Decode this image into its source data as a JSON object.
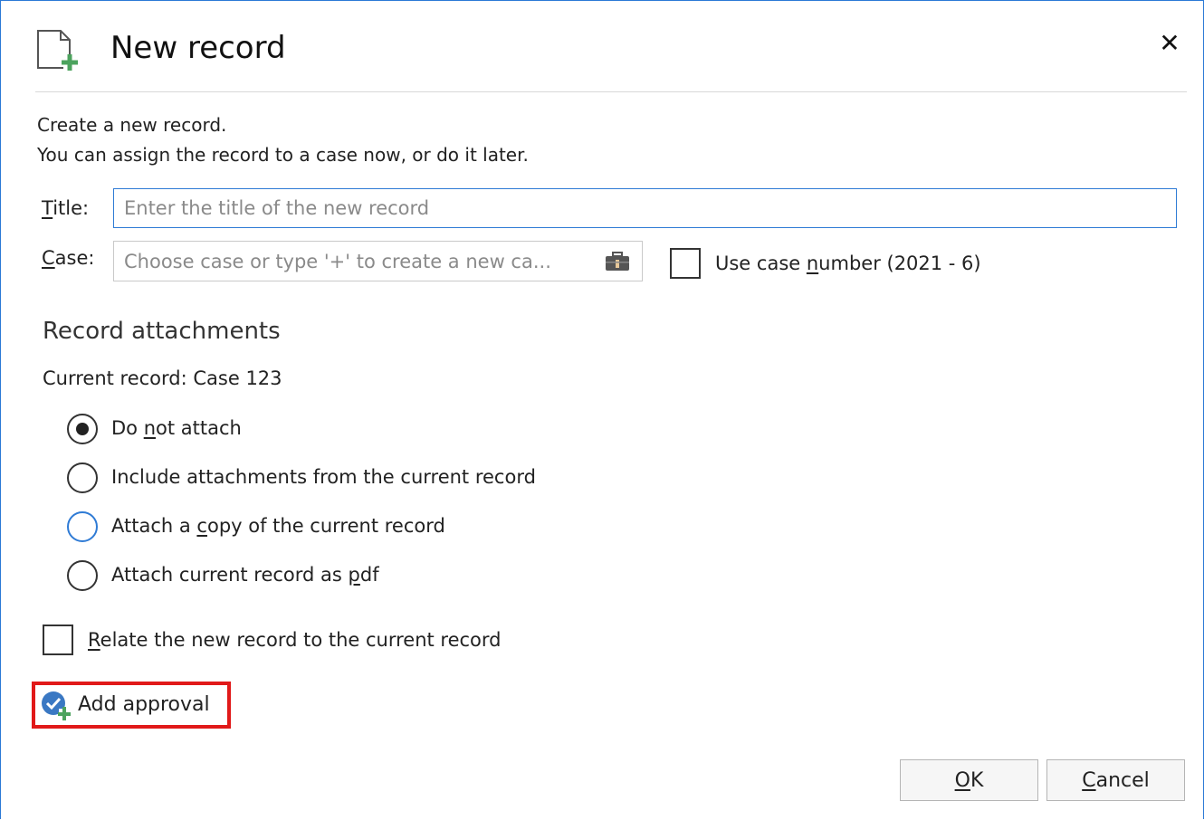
{
  "dialog": {
    "title": "New record",
    "close_glyph": "✕",
    "icon": "new-document-icon"
  },
  "intro": {
    "line1": "Create a new record.",
    "line2": "You can assign the record to a case now, or do it later."
  },
  "fields": {
    "title": {
      "label_mnemonic": "T",
      "label_rest": "itle:",
      "value": "",
      "placeholder": "Enter the title of the new record"
    },
    "case": {
      "label_mnemonic": "C",
      "label_rest": "ase:",
      "placeholder": "Choose case or type '+' to create a new ca...",
      "icon": "briefcase-icon"
    },
    "use_case_number": {
      "label_pre": "Use case ",
      "label_mnemonic": "n",
      "label_post": "umber (2021 - 6)",
      "checked": false
    }
  },
  "attachments": {
    "section_title": "Record attachments",
    "current_record_text": "Current record: Case 123",
    "options": [
      {
        "pre": "Do ",
        "mn": "n",
        "post": "ot attach",
        "selected": true
      },
      {
        "pre": "Include attachments from the current record",
        "mn": "",
        "post": "",
        "selected": false
      },
      {
        "pre": "Attach a ",
        "mn": "c",
        "post": "opy of the current record",
        "selected": false,
        "focused": true
      },
      {
        "pre": "Attach current record as ",
        "mn": "p",
        "post": "df",
        "selected": false
      }
    ]
  },
  "relate": {
    "label_mnemonic": "R",
    "label_rest": "elate the new record to the current record",
    "checked": false
  },
  "approval": {
    "label": "Add approval",
    "icon": "approval-check-icon",
    "highlight_color": "#e11919"
  },
  "buttons": {
    "ok": {
      "mnemonic": "O",
      "rest": "K"
    },
    "cancel": {
      "mnemonic": "C",
      "rest": "ancel"
    }
  },
  "colors": {
    "accent": "#2f7bd5",
    "border": "#2b79d6"
  }
}
